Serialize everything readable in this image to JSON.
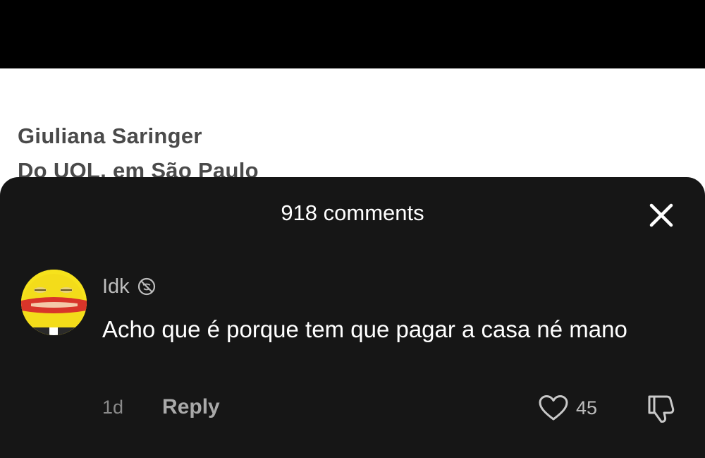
{
  "article": {
    "author": "Giuliana Saringer",
    "source": "Do UOL, em São Paulo"
  },
  "comments_sheet": {
    "title": "918 comments",
    "close_icon": "close-icon",
    "comment": {
      "username": "Idk",
      "badge_icon": "muted-icon",
      "text": "Acho que é porque tem que pagar a casa né mano",
      "time": "1d",
      "reply_label": "Reply",
      "like_count": "45",
      "like_icon": "heart-icon",
      "dislike_icon": "thumbs-down-icon"
    }
  },
  "colors": {
    "sheet_background": "#161616",
    "top_bar": "#000000",
    "avatar_yellow": "#f6e21c"
  }
}
